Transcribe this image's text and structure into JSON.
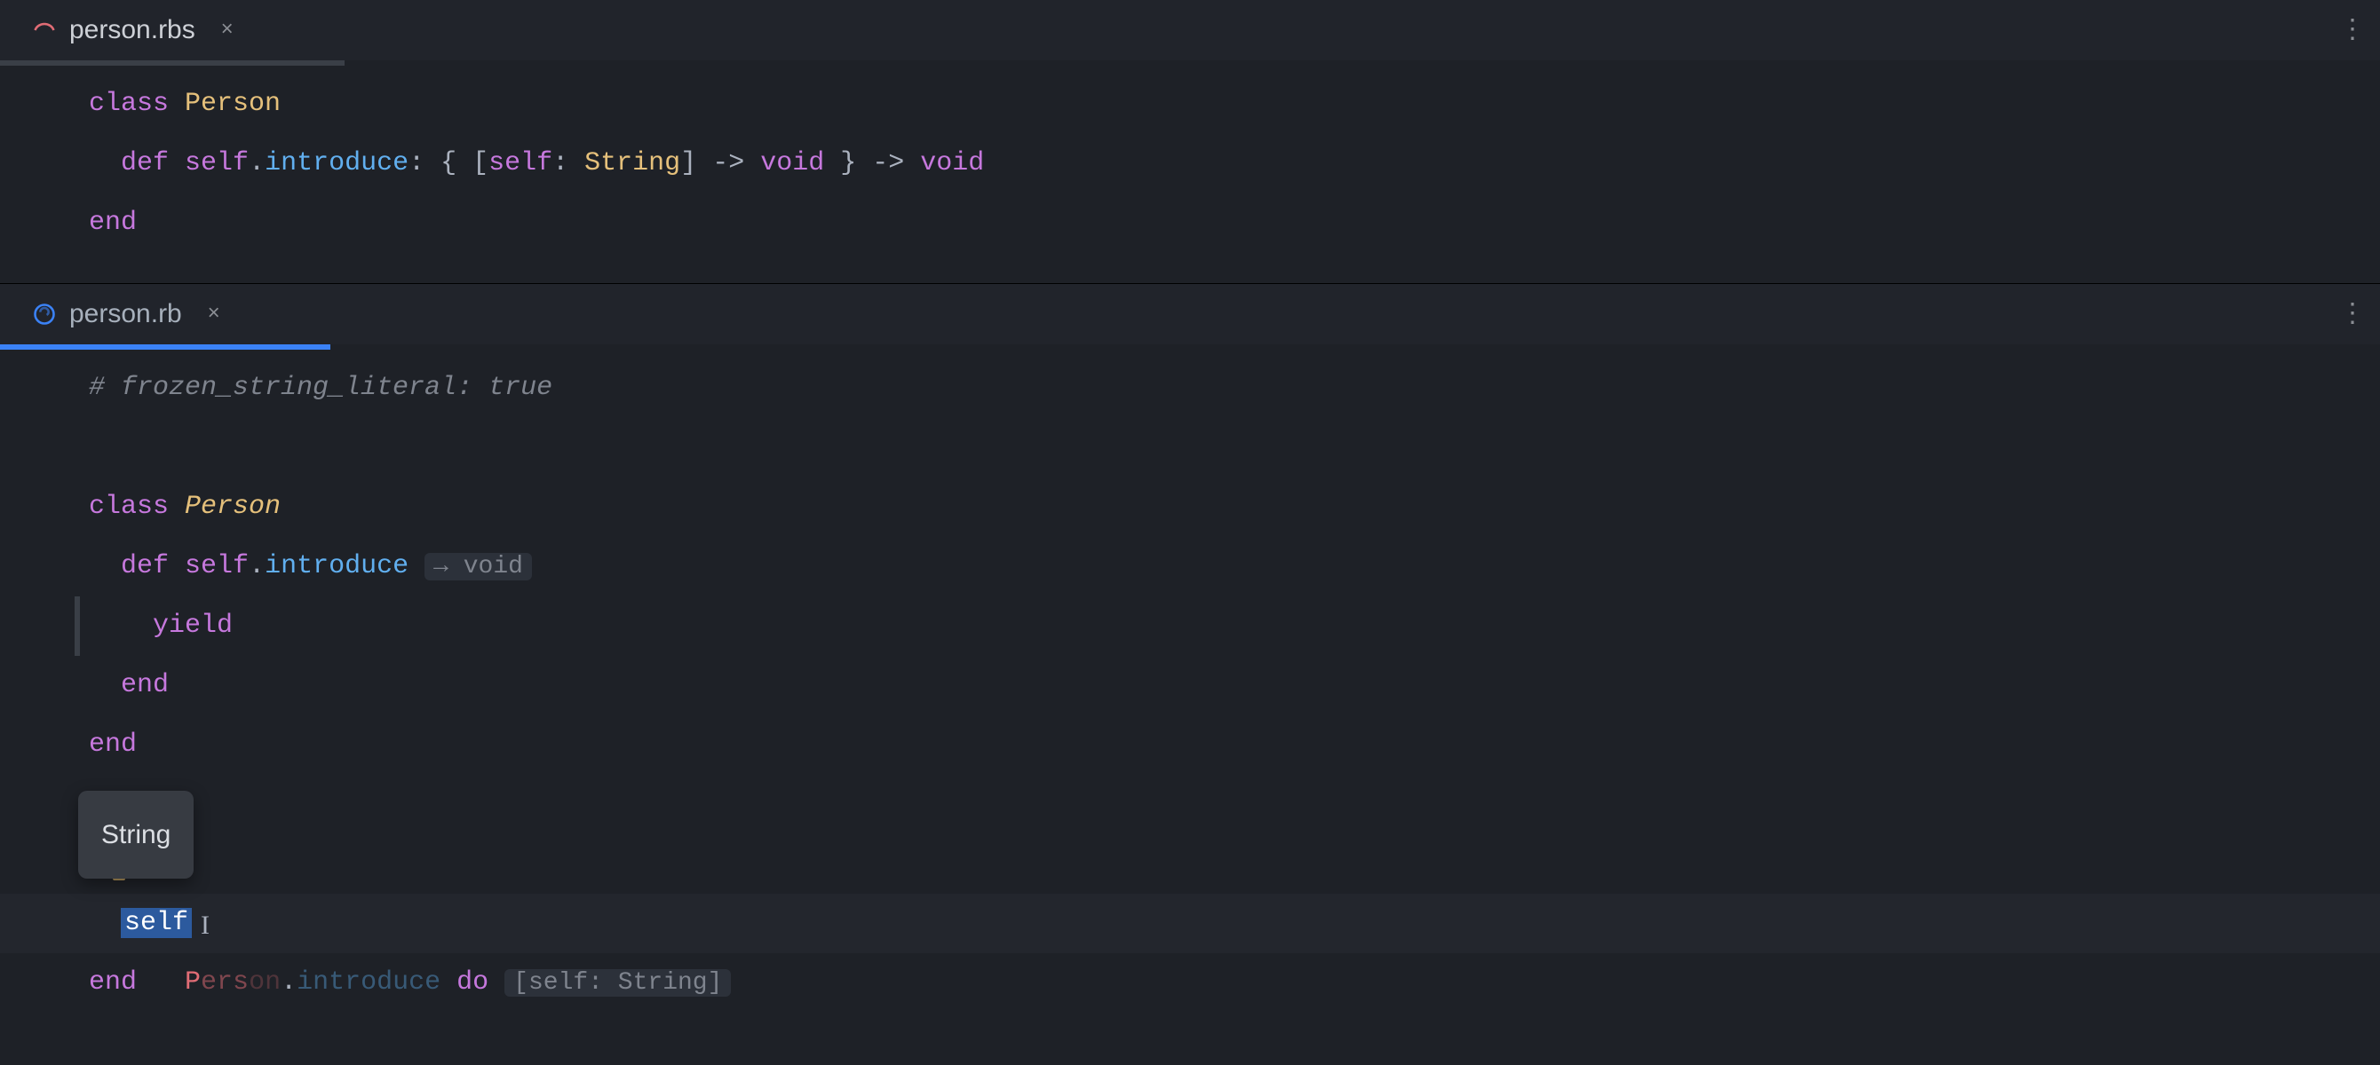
{
  "colors": {
    "bg": "#1e2127",
    "accent": "#3b82f6",
    "keyword": "#c678dd",
    "type": "#e5c07b",
    "method": "#61afef",
    "comment": "#7f848e",
    "ident": "#e06c75",
    "selection": "#2c5a9e"
  },
  "pane_top": {
    "tab": {
      "filename": "person.rbs",
      "icon_color": "#e06c75"
    },
    "code": {
      "lines": [
        {
          "tokens": [
            {
              "t": "class",
              "c": "kw"
            },
            {
              "t": " "
            },
            {
              "t": "Person",
              "c": "type"
            }
          ]
        },
        {
          "tokens": [
            {
              "t": "  "
            },
            {
              "t": "def",
              "c": "kw"
            },
            {
              "t": " "
            },
            {
              "t": "self",
              "c": "self"
            },
            {
              "t": "."
            },
            {
              "t": "introduce",
              "c": "method"
            },
            {
              "t": ": { ["
            },
            {
              "t": "self",
              "c": "self"
            },
            {
              "t": ": "
            },
            {
              "t": "String",
              "c": "type"
            },
            {
              "t": "] -> "
            },
            {
              "t": "void",
              "c": "self"
            },
            {
              "t": " } -> "
            },
            {
              "t": "void",
              "c": "self"
            }
          ]
        },
        {
          "tokens": [
            {
              "t": "end",
              "c": "end"
            }
          ]
        }
      ]
    }
  },
  "pane_bottom": {
    "tab": {
      "filename": "person.rb",
      "icon_color": "#3b82f6"
    },
    "code": {
      "comment": "# frozen_string_literal: true",
      "class_kw": "class",
      "class_name": "Person",
      "def_kw": "def",
      "self_kw": "self",
      "method_name": "introduce",
      "return_hint": "→ void",
      "yield_kw": "yield",
      "end_kw": "end",
      "call_receiver": "Person",
      "call_method": "introduce",
      "do_kw": "do",
      "block_hint": "[self: String]",
      "self_in_block": "self",
      "tooltip": "String"
    },
    "current_line_index": 9
  }
}
